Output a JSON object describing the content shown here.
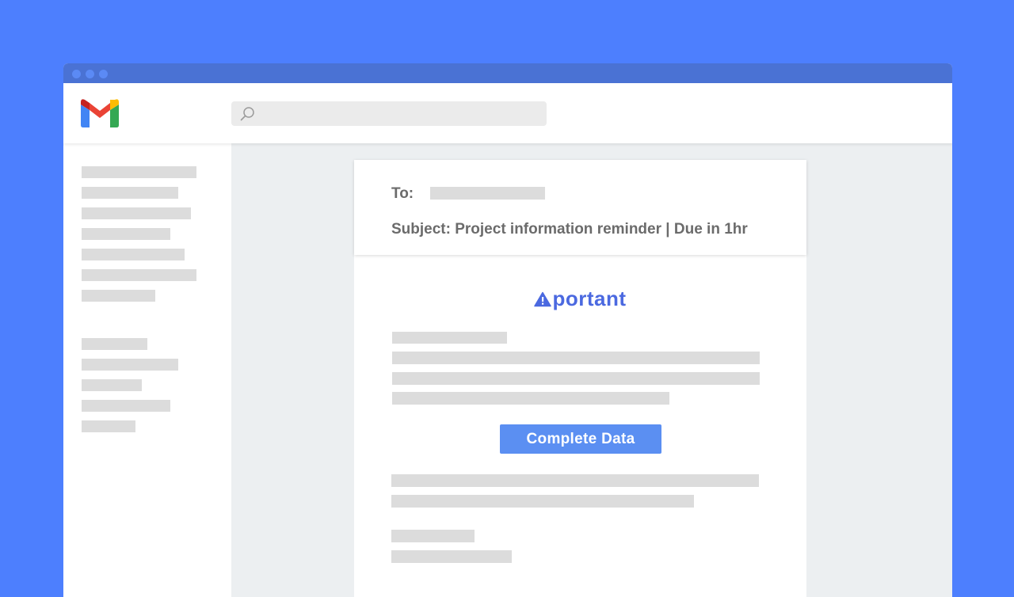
{
  "email": {
    "to_label": "To:",
    "subject": "Subject: Project information reminder | Due in 1hr"
  },
  "body": {
    "brand_name": "portant",
    "cta_label": "Complete Data"
  },
  "icons": {
    "logo": "gmail-logo-icon",
    "search": "search-icon",
    "brand": "warning-triangle-icon"
  },
  "colors": {
    "background": "#4d7ffe",
    "titlebar": "#4a72d4",
    "brand": "#4b69e0",
    "cta": "#5b8ff2",
    "placeholder_bar": "#dcdcdc",
    "main_bg": "#eceff1"
  }
}
